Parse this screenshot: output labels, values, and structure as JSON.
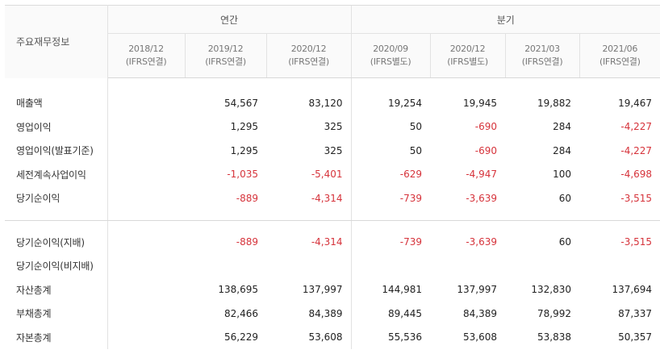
{
  "header": {
    "corner": "주요재무정보",
    "groups": {
      "annual": "연간",
      "quarterly": "분기"
    },
    "periods": [
      {
        "date": "2018/12",
        "basis": "(IFRS연결)"
      },
      {
        "date": "2019/12",
        "basis": "(IFRS연결)"
      },
      {
        "date": "2020/12",
        "basis": "(IFRS연결)"
      },
      {
        "date": "2020/09",
        "basis": "(IFRS별도)"
      },
      {
        "date": "2020/12",
        "basis": "(IFRS별도)"
      },
      {
        "date": "2021/03",
        "basis": "(IFRS연결)"
      },
      {
        "date": "2021/06",
        "basis": "(IFRS연결)"
      }
    ]
  },
  "rows": [
    {
      "label": "매출액",
      "values": [
        "",
        "54,567",
        "83,120",
        "19,254",
        "19,945",
        "19,882",
        "19,467"
      ]
    },
    {
      "label": "영업이익",
      "values": [
        "",
        "1,295",
        "325",
        "50",
        "-690",
        "284",
        "-4,227"
      ]
    },
    {
      "label": "영업이익(발표기준)",
      "values": [
        "",
        "1,295",
        "325",
        "50",
        "-690",
        "284",
        "-4,227"
      ]
    },
    {
      "label": "세전계속사업이익",
      "values": [
        "",
        "-1,035",
        "-5,401",
        "-629",
        "-4,947",
        "100",
        "-4,698"
      ]
    },
    {
      "label": "당기순이익",
      "values": [
        "",
        "-889",
        "-4,314",
        "-739",
        "-3,639",
        "60",
        "-3,515"
      ]
    },
    {
      "label": "당기순이익(지배)",
      "values": [
        "",
        "-889",
        "-4,314",
        "-739",
        "-3,639",
        "60",
        "-3,515"
      ]
    },
    {
      "label": "당기순이익(비지배)",
      "values": [
        "",
        "",
        "",
        "",
        "",
        "",
        ""
      ]
    },
    {
      "label": "자산총계",
      "values": [
        "",
        "138,695",
        "137,997",
        "144,981",
        "137,997",
        "132,830",
        "137,694"
      ]
    },
    {
      "label": "부채총계",
      "values": [
        "",
        "82,466",
        "84,389",
        "89,445",
        "84,389",
        "78,992",
        "87,337"
      ]
    },
    {
      "label": "자본총계",
      "values": [
        "",
        "56,229",
        "53,608",
        "55,536",
        "53,608",
        "53,838",
        "50,357"
      ]
    }
  ],
  "colors": {
    "negative": "#d6333b",
    "text": "#222222",
    "header_bg": "#fafafa",
    "border": "#e2e2e2"
  }
}
